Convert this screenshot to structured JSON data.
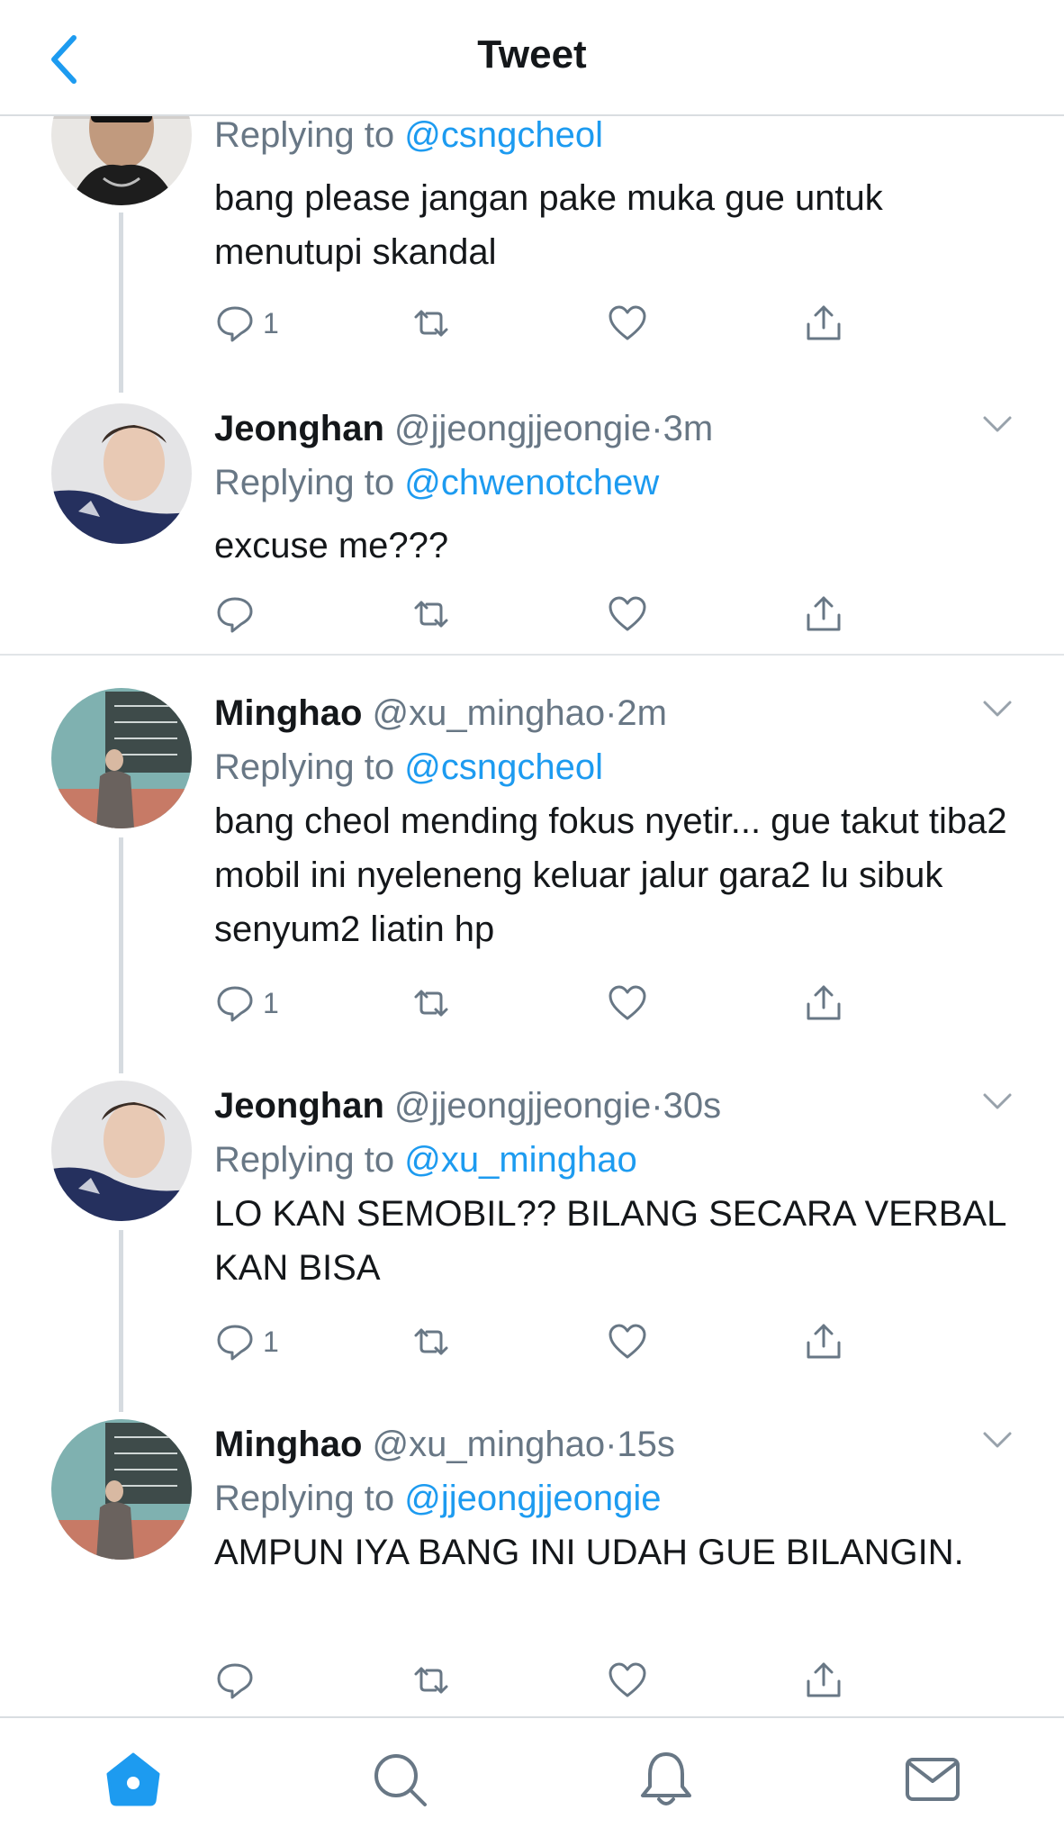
{
  "header": {
    "title": "Tweet"
  },
  "tweets": [
    {
      "name": "",
      "handle": "",
      "time": "",
      "replying_prefix": "Replying to",
      "replying_to": "@csngcheol",
      "text": "bang please jangan pake muka gue untuk menutupi skandal",
      "reply_count": "1"
    },
    {
      "name": "Jeonghan",
      "handle": "@jjeongjjeongie",
      "time": "3m",
      "replying_prefix": "Replying to",
      "replying_to": "@chwenotchew",
      "text": "excuse me???",
      "reply_count": ""
    },
    {
      "name": "Minghao",
      "handle": "@xu_minghao",
      "time": "2m",
      "replying_prefix": "Replying to",
      "replying_to": "@csngcheol",
      "text": "bang cheol mending fokus nyetir... gue takut tiba2 mobil ini nyeleneng keluar jalur gara2 lu sibuk senyum2 liatin hp",
      "reply_count": "1"
    },
    {
      "name": "Jeonghan",
      "handle": "@jjeongjjeongie",
      "time": "30s",
      "replying_prefix": "Replying to",
      "replying_to": "@xu_minghao",
      "text": "LO KAN SEMOBIL?? BILANG SECARA VERBAL KAN BISA",
      "reply_count": "1"
    },
    {
      "name": "Minghao",
      "handle": "@xu_minghao",
      "time": "15s",
      "replying_prefix": "Replying to",
      "replying_to": "@jjeongjjeongie",
      "text": "AMPUN IYA BANG INI UDAH GUE BILANGIN.",
      "reply_count": ""
    }
  ],
  "separator": "·",
  "icons": {
    "back": "chevron-left-icon",
    "more": "chevron-down-icon",
    "reply": "reply-bubble-icon",
    "retweet": "retweet-icon",
    "like": "heart-icon",
    "share": "share-icon",
    "home": "home-icon",
    "search": "search-icon",
    "notifications": "bell-icon",
    "messages": "envelope-icon"
  },
  "colors": {
    "accent": "#1d9bf0",
    "text": "#14171a",
    "muted": "#687785"
  }
}
